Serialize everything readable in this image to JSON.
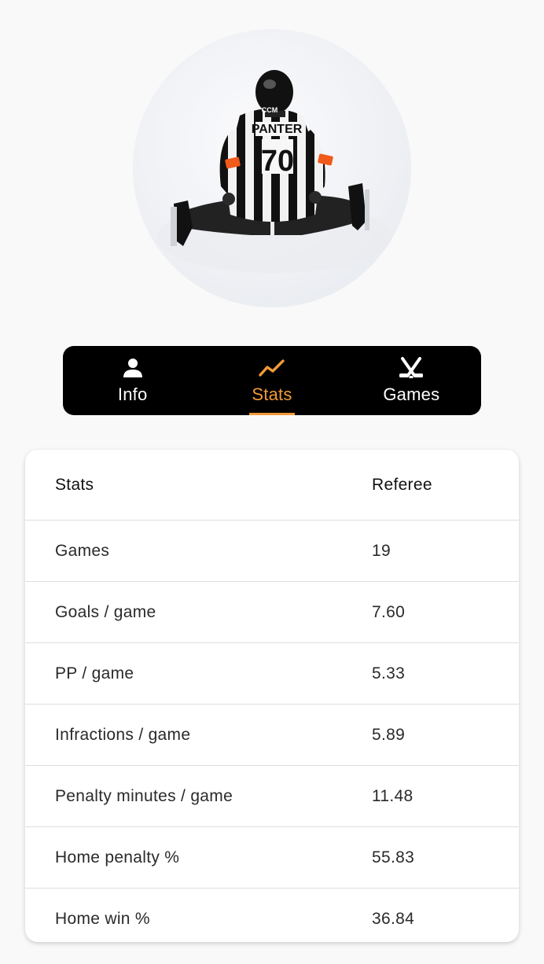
{
  "profile": {
    "jersey_name": "PANTER",
    "jersey_number": "70",
    "jersey_brand": "CCM"
  },
  "tabs": [
    {
      "label": "Info",
      "icon": "person-icon",
      "active": false
    },
    {
      "label": "Stats",
      "icon": "trend-icon",
      "active": true
    },
    {
      "label": "Games",
      "icon": "hockey-sticks-icon",
      "active": false
    }
  ],
  "accent_color": "#f09a38",
  "stats_table": {
    "headers": [
      "Stats",
      "Referee"
    ],
    "rows": [
      {
        "name": "Games",
        "value": "19"
      },
      {
        "name": "Goals / game",
        "value": "7.60"
      },
      {
        "name": "PP / game",
        "value": "5.33"
      },
      {
        "name": "Infractions / game",
        "value": "5.89"
      },
      {
        "name": "Penalty minutes / game",
        "value": "11.48"
      },
      {
        "name": "Home penalty %",
        "value": "55.83"
      },
      {
        "name": "Home win %",
        "value": "36.84"
      }
    ]
  }
}
